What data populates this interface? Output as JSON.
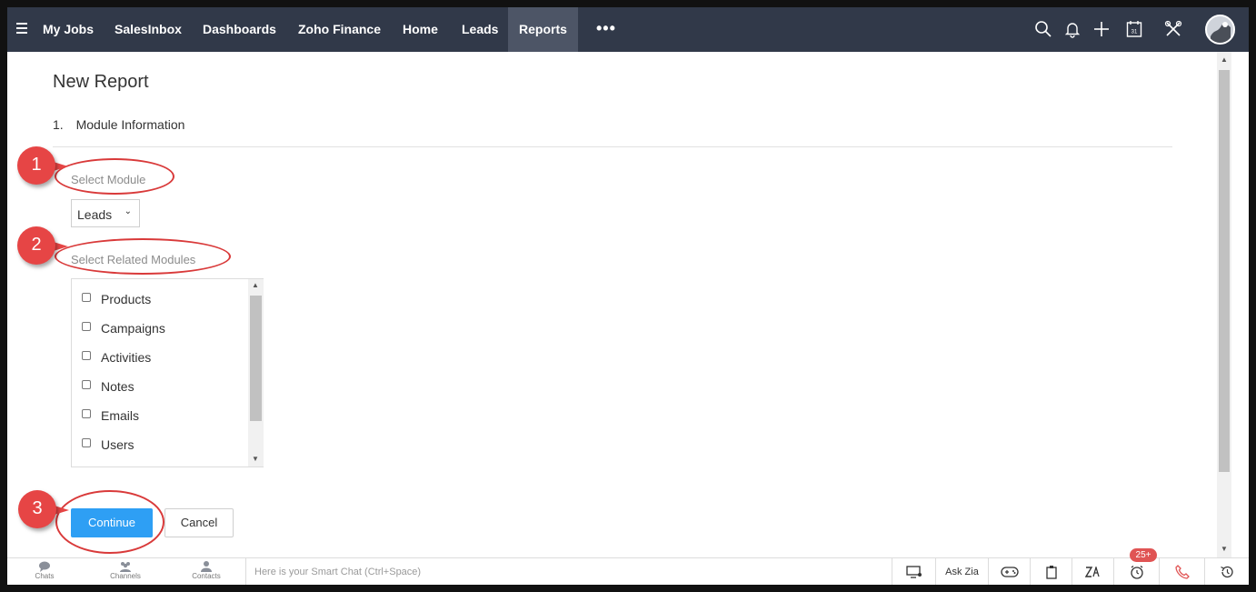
{
  "nav": {
    "items": [
      "My Jobs",
      "SalesInbox",
      "Dashboards",
      "Zoho Finance",
      "Home",
      "Leads",
      "Reports"
    ],
    "active": "Reports",
    "more": "•••"
  },
  "page": {
    "title": "New Report",
    "step_number": "1.",
    "step_title": "Module Information",
    "select_module_label": "Select Module",
    "module_value": "Leads",
    "related_label": "Select Related Modules",
    "related_modules": [
      "Products",
      "Campaigns",
      "Activities",
      "Notes",
      "Emails",
      "Users"
    ],
    "continue_label": "Continue",
    "cancel_label": "Cancel"
  },
  "annotations": [
    "1",
    "2",
    "3"
  ],
  "bottom_bar": {
    "chats": "Chats",
    "channels": "Channels",
    "contacts": "Contacts",
    "smart_chat_placeholder": "Here is your Smart Chat (Ctrl+Space)",
    "ask_zia": "Ask Zia",
    "notification_badge": "25+"
  },
  "icons": {
    "top": [
      "search-icon",
      "bell-icon",
      "plus-icon",
      "calendar-icon",
      "tools-icon"
    ],
    "bottom": [
      "screen-share-icon",
      "gamepad-icon",
      "clipboard-icon",
      "zia-icon",
      "alarm-icon",
      "phone-icon",
      "history-icon"
    ]
  },
  "colors": {
    "topbar": "#313949",
    "primary_button": "#2e9ff4",
    "annotation": "#e64545"
  }
}
